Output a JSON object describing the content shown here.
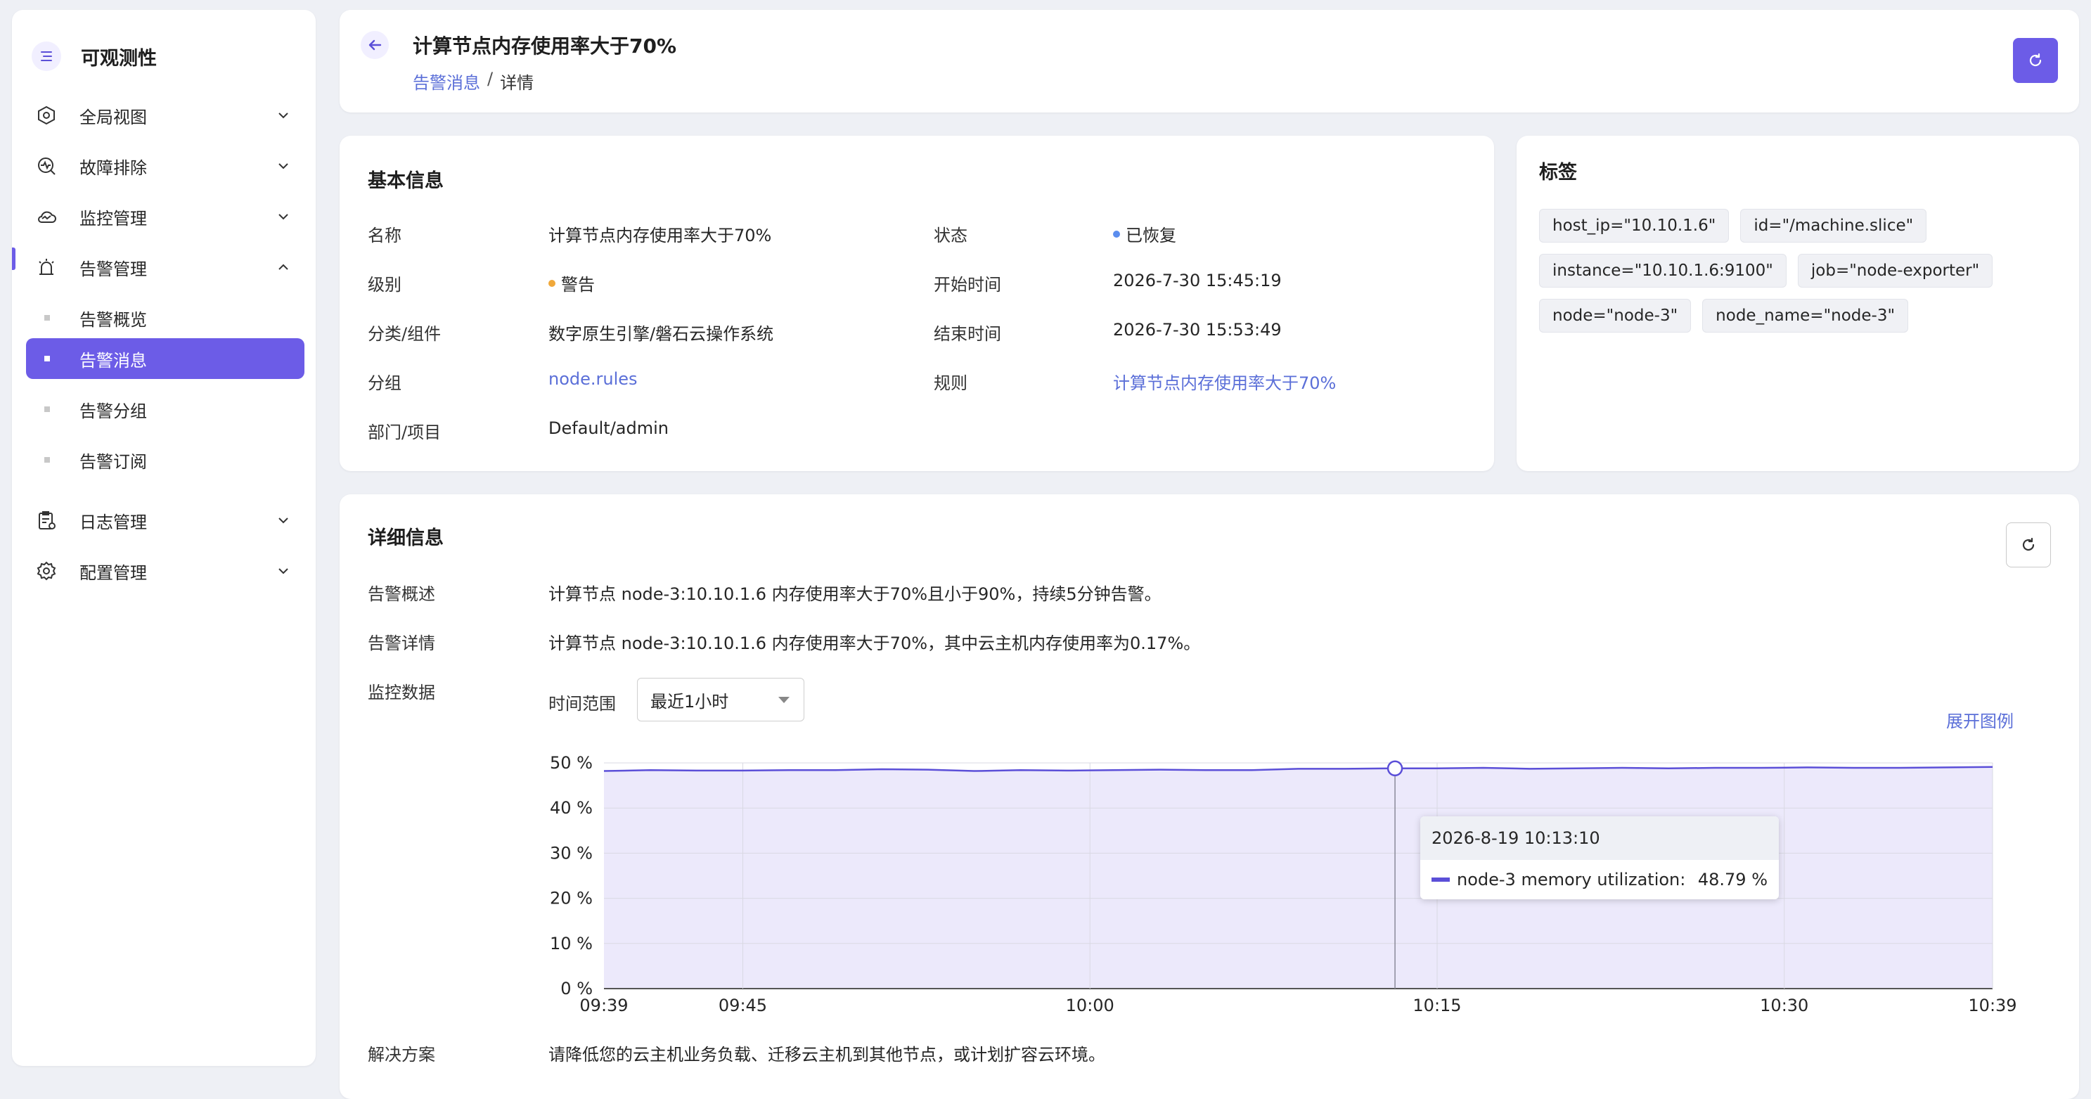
{
  "sidebar": {
    "brand": "可观测性",
    "items": [
      {
        "label": "全局视图",
        "icon": "cluster-icon"
      },
      {
        "label": "故障排除",
        "icon": "troubleshoot-icon"
      },
      {
        "label": "监控管理",
        "icon": "cloud-monitor-icon"
      },
      {
        "label": "告警管理",
        "icon": "alarm-icon"
      },
      {
        "label": "日志管理",
        "icon": "log-clipboard-icon"
      },
      {
        "label": "配置管理",
        "icon": "gear-icon"
      }
    ],
    "alert_sub": [
      {
        "label": "告警概览"
      },
      {
        "label": "告警消息"
      },
      {
        "label": "告警分组"
      },
      {
        "label": "告警订阅"
      }
    ],
    "active_item": "告警消息"
  },
  "header": {
    "title": "计算节点内存使用率大于70%",
    "breadcrumb": {
      "parent": "告警消息",
      "sep": "/",
      "current": "详情"
    }
  },
  "basic": {
    "title": "基本信息",
    "name_label": "名称",
    "name_value": "计算节点内存使用率大于70%",
    "level_label": "级别",
    "level_value": "警告",
    "category_label": "分类/组件",
    "category_value": "数字原生引擎/磐石云操作系统",
    "group_label": "分组",
    "group_value": "node.rules",
    "dept_label": "部门/项目",
    "dept_value": "Default/admin",
    "status_label": "状态",
    "status_value": "已恢复",
    "start_label": "开始时间",
    "start_value": "2026-7-30 15:45:19",
    "end_label": "结束时间",
    "end_value": "2026-7-30 15:53:49",
    "rule_label": "规则",
    "rule_value": "计算节点内存使用率大于70%"
  },
  "colors": {
    "accent": "#6c5ce7",
    "link": "#5b6fd8",
    "warn": "#f0a83a",
    "recovered": "#5b8dee",
    "series": "#5b4fd8"
  },
  "tags": {
    "title": "标签",
    "items": [
      "host_ip=\"10.10.1.6\"",
      "id=\"/machine.slice\"",
      "instance=\"10.10.1.6:9100\"",
      "job=\"node-exporter\"",
      "node=\"node-3\"",
      "node_name=\"node-3\""
    ]
  },
  "detail": {
    "title": "详细信息",
    "summary_label": "告警概述",
    "summary_value": "计算节点 node-3:10.10.1.6 内存使用率大于70%且小于90%，持续5分钟告警。",
    "desc_label": "告警详情",
    "desc_value": "计算节点 node-3:10.10.1.6 内存使用率大于70%，其中云主机内存使用率为0.17%。",
    "monitor_label": "监控数据",
    "range_label": "时间范围",
    "range_value": "最近1小时",
    "legend_toggle": "展开图例",
    "solution_label": "解决方案",
    "solution_value": "请降低您的云主机业务负载、迁移云主机到其他节点，或计划扩容云环境。"
  },
  "tooltip": {
    "time": "2026-8-19 10:13:10",
    "series": "node-3 memory utilization:",
    "value": "48.79 %"
  },
  "chart_data": {
    "type": "area",
    "x_tick_labels": [
      "09:39",
      "09:45",
      "10:00",
      "10:15",
      "10:30",
      "10:39"
    ],
    "x_tick_minutes": [
      0,
      6,
      21,
      36,
      51,
      60
    ],
    "y_tick_labels": [
      "0 %",
      "10 %",
      "20 %",
      "30 %",
      "40 %",
      "50 %"
    ],
    "ylim": [
      0,
      50
    ],
    "xlim_minutes": [
      0,
      60
    ],
    "grid": true,
    "series": [
      {
        "name": "node-3 memory utilization",
        "x_minutes": [
          0,
          2,
          4,
          6,
          8,
          10,
          12,
          14,
          16,
          18,
          20,
          22,
          24,
          26,
          28,
          30,
          32,
          34,
          34.18,
          36,
          38,
          40,
          42,
          44,
          46,
          48,
          50,
          52,
          54,
          56,
          58,
          60
        ],
        "values": [
          48.2,
          48.4,
          48.3,
          48.3,
          48.4,
          48.4,
          48.6,
          48.5,
          48.2,
          48.4,
          48.3,
          48.4,
          48.5,
          48.4,
          48.4,
          48.7,
          48.7,
          48.8,
          48.79,
          48.8,
          48.9,
          48.7,
          48.8,
          48.9,
          48.8,
          48.9,
          48.9,
          49.0,
          48.9,
          48.9,
          49.0,
          49.1
        ]
      }
    ],
    "highlight_x_minutes": 34.18
  }
}
